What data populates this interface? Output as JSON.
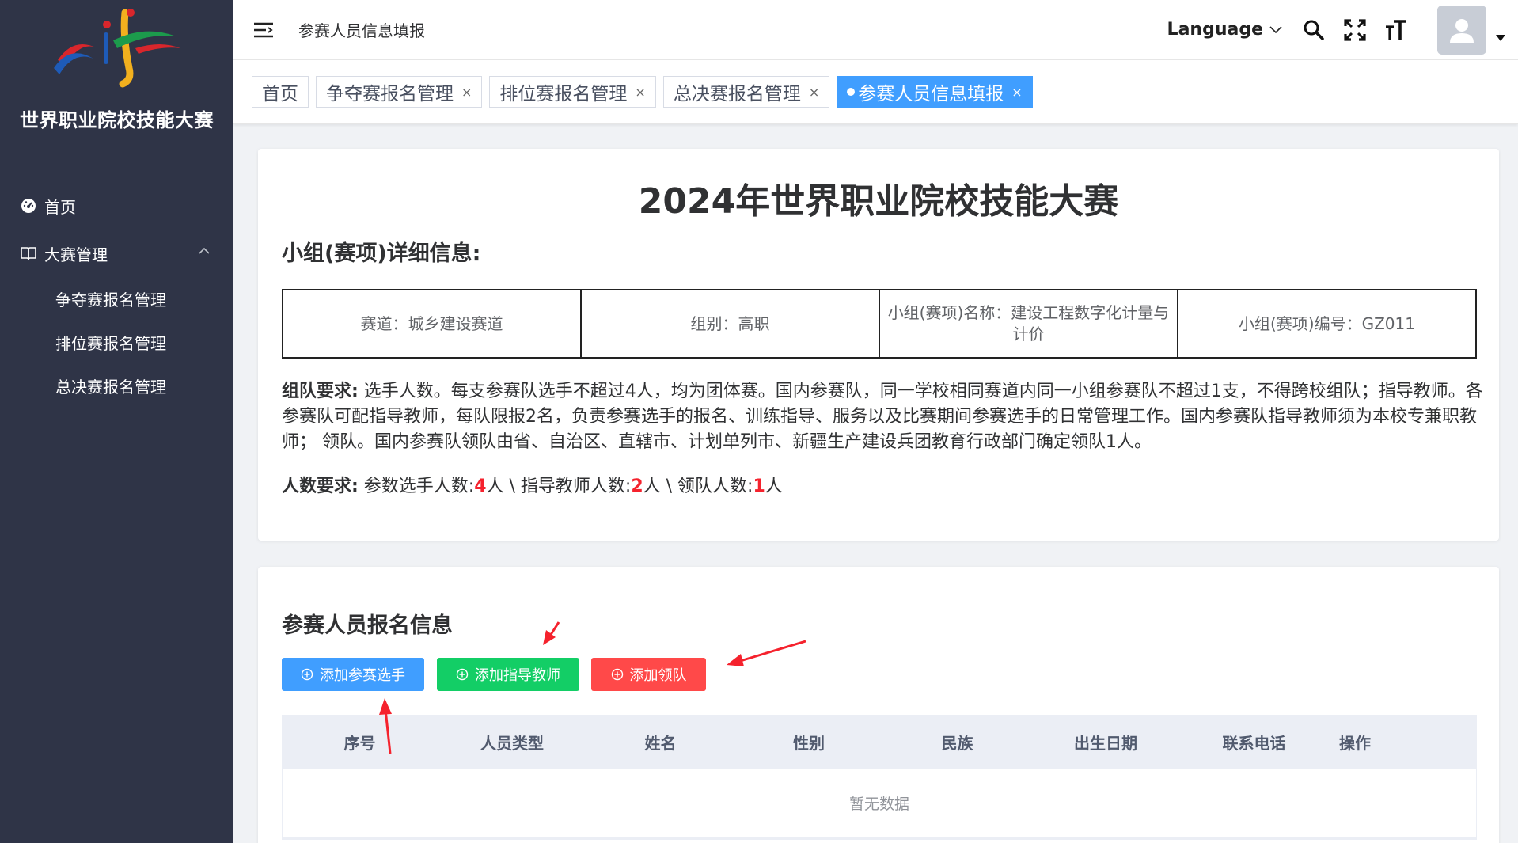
{
  "sidebar": {
    "logo_title": "世界职业院校技能大赛",
    "home_label": "首页",
    "group_label": "大赛管理",
    "sub_items": [
      "争夺赛报名管理",
      "排位赛报名管理",
      "总决赛报名管理"
    ]
  },
  "header": {
    "breadcrumb": "参赛人员信息填报",
    "language_label": "Language"
  },
  "tags": [
    {
      "label": "首页",
      "closable": false,
      "active": false
    },
    {
      "label": "争夺赛报名管理",
      "closable": true,
      "active": false
    },
    {
      "label": "排位赛报名管理",
      "closable": true,
      "active": false
    },
    {
      "label": "总决赛报名管理",
      "closable": true,
      "active": false
    },
    {
      "label": "参赛人员信息填报",
      "closable": true,
      "active": true
    }
  ],
  "detail": {
    "main_title": "2024年世界职业院校技能大赛",
    "section_title": "小组(赛项)详细信息:",
    "cells": [
      "赛道：城乡建设赛道",
      "组别：高职",
      "小组(赛项)名称：建设工程数字化计量与计价",
      "小组(赛项)编号：GZ011"
    ],
    "team_req_label": "组队要求:",
    "team_req_text": " 选手人数。每支参赛队选手不超过4人，均为团体赛。国内参赛队，同一学校相同赛道内同一小组参赛队不超过1支，不得跨校组队；指导教师。各参赛队可配指导教师，每队限报2名，负责参赛选手的报名、训练指导、服务以及比赛期间参赛选手的日常管理工作。国内参赛队指导教师须为本校专兼职教师；  领队。国内参赛队领队由省、自治区、直辖市、计划单列市、新疆生产建设兵团教育行政部门确定领队1人。",
    "count_req_label": "人数要求:",
    "count_req": {
      "players_label": " 参数选手人数:",
      "players_value": "4",
      "players_unit": "人 \\ 指导教师人数:",
      "teachers_value": "2",
      "teachers_unit": "人 \\ 领队人数:",
      "leaders_value": "1",
      "leaders_unit": "人"
    }
  },
  "registration": {
    "section_title": "参赛人员报名信息",
    "buttons": {
      "add_player": "添加参赛选手",
      "add_teacher": "添加指导教师",
      "add_leader": "添加领队"
    },
    "columns": [
      "序号",
      "人员类型",
      "姓名",
      "性别",
      "民族",
      "出生日期",
      "联系电话",
      "操作"
    ],
    "empty_text": "暂无数据"
  },
  "colors": {
    "sidebar_bg": "#2f3447",
    "primary": "#409eff",
    "success": "#13ce66",
    "danger": "#ff4949",
    "annotation_arrow": "#f5222d"
  }
}
